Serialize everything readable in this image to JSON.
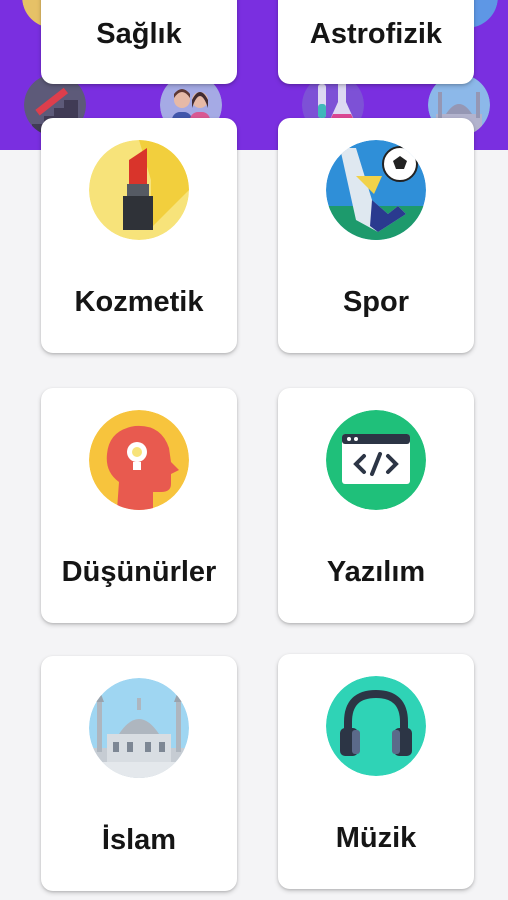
{
  "colors": {
    "header_bg": "#7a2fe0",
    "page_bg": "#f4f4f6",
    "card_bg": "#ffffff",
    "label": "#151515"
  },
  "categories_top": [
    {
      "label": "Sağlık"
    },
    {
      "label": "Astrofizik"
    }
  ],
  "categories": [
    {
      "label": "Kozmetik",
      "icon": "lipstick-icon"
    },
    {
      "label": "Spor",
      "icon": "soccer-icon"
    },
    {
      "label": "Düşünürler",
      "icon": "thinker-icon"
    },
    {
      "label": "Yazılım",
      "icon": "code-icon"
    },
    {
      "label": "İslam",
      "icon": "mosque-icon"
    },
    {
      "label": "Müzik",
      "icon": "headphones-icon"
    }
  ]
}
